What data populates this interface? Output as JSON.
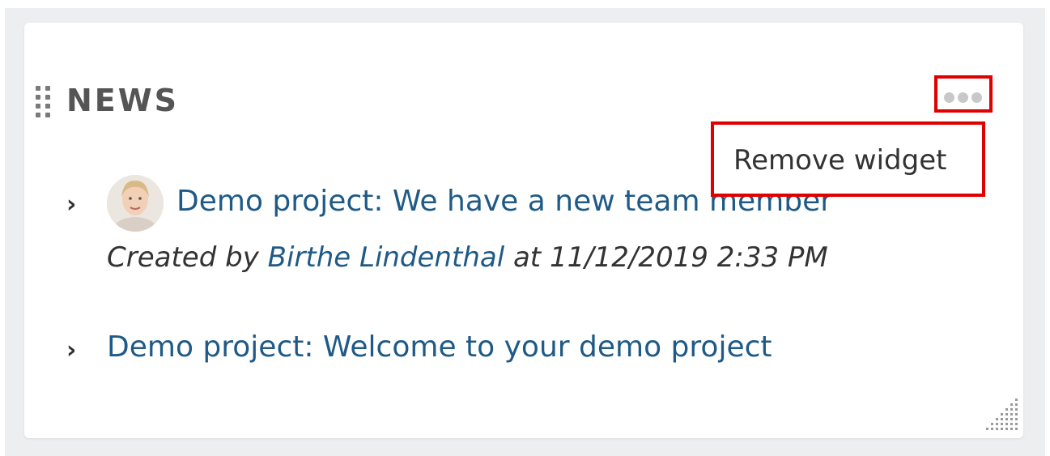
{
  "widget": {
    "title": "NEWS",
    "menu": {
      "icon": "more-horizontal-icon",
      "items": [
        {
          "label": "Remove widget"
        }
      ]
    },
    "news": [
      {
        "title": "Demo project: We have a new team member",
        "meta_prefix": "Created by",
        "author": "Birthe Lindenthal",
        "meta_mid": "at",
        "datetime": "11/12/2019 2:33 PM",
        "has_avatar": true
      },
      {
        "title": "Demo project: Welcome to your demo project",
        "has_avatar": false
      }
    ]
  },
  "colors": {
    "link": "#1f5a86",
    "highlight": "#e00000",
    "title": "#555555",
    "background": "#eceef0"
  }
}
